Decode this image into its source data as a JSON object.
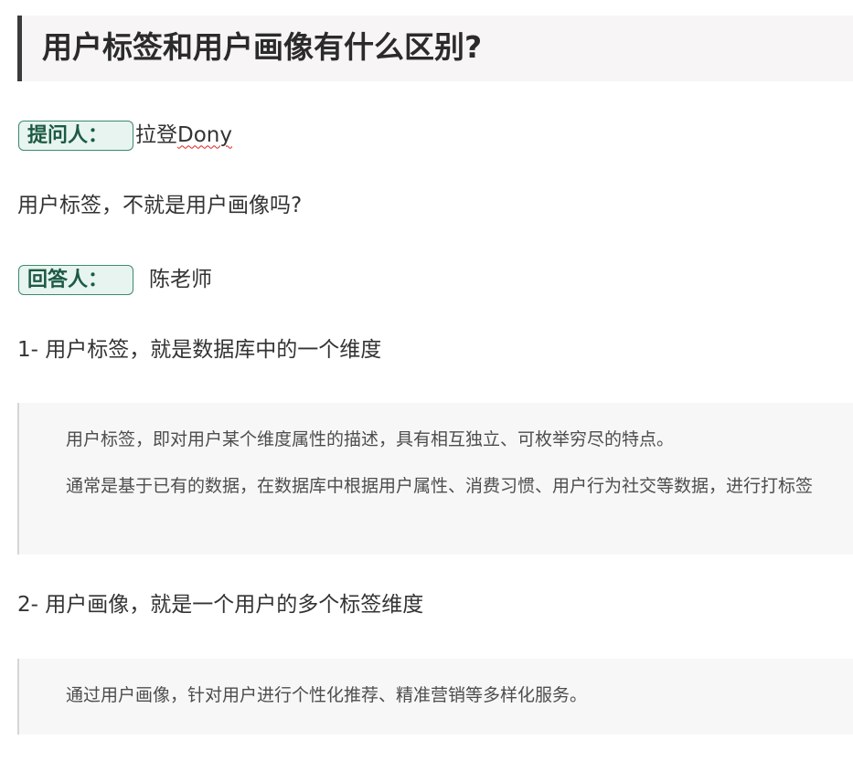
{
  "title": "用户标签和用户画像有什么区别?",
  "asker": {
    "label": "提问人：",
    "name_prefix": "拉登",
    "name_suffix": "Dony"
  },
  "question": "用户标签，不就是用户画像吗?",
  "answerer": {
    "label": "回答人：",
    "name": "陈老师"
  },
  "section1": {
    "heading": "1-  用户标签，就是数据库中的一个维度",
    "quote_line1": "用户标签，即对用户某个维度属性的描述，具有相互独立、可枚举穷尽的特点。",
    "quote_line2": "通常是基于已有的数据，在数据库中根据用户属性、消费习惯、用户行为社交等数据，进行打标签"
  },
  "section2": {
    "heading": "2-  用户画像，就是一个用户的多个标签维度",
    "quote_line1": "通过用户画像，针对用户进行个性化推荐、精准营销等多样化服务。"
  }
}
